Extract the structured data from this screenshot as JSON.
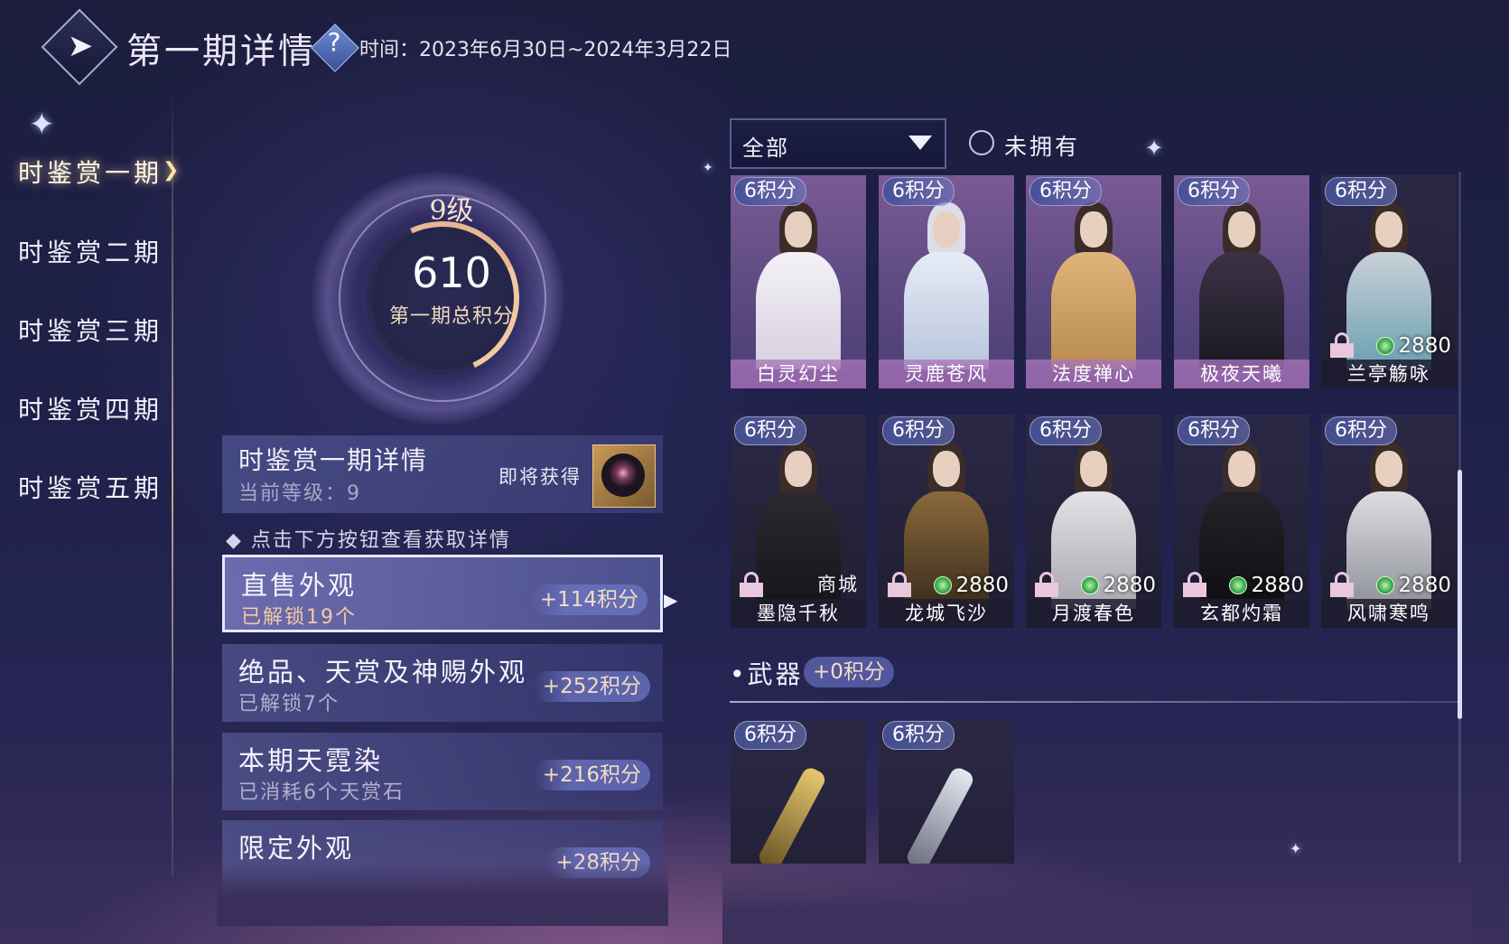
{
  "header": {
    "title": "第一期详情",
    "help_symbol": "?",
    "time_text": "时间：2023年6月30日~2024年3月22日"
  },
  "sidebar": {
    "items": [
      {
        "label": "时鉴赏一期",
        "active": true
      },
      {
        "label": "时鉴赏二期",
        "active": false
      },
      {
        "label": "时鉴赏三期",
        "active": false
      },
      {
        "label": "时鉴赏四期",
        "active": false
      },
      {
        "label": "时鉴赏五期",
        "active": false
      }
    ]
  },
  "score": {
    "level": "9级",
    "total": "610",
    "label": "第一期总积分"
  },
  "detail": {
    "title": "时鉴赏一期详情",
    "current_level": "当前等级：9",
    "soon_label": "即将获得",
    "hint": "点击下方按钮查看获取详情"
  },
  "categories": [
    {
      "name": "直售外观",
      "sub": "已解锁19个",
      "points": "+114积分",
      "active": true
    },
    {
      "name": "绝品、天赏及神赐外观",
      "sub": "已解锁7个",
      "points": "+252积分",
      "active": false
    },
    {
      "name": "本期天霓染",
      "sub": "已消耗6个天赏石",
      "points": "+216积分",
      "active": false
    },
    {
      "name": "限定外观",
      "sub": "",
      "points": "+28积分",
      "active": false
    }
  ],
  "filter": {
    "selected": "全部",
    "unowned_label": "未拥有"
  },
  "outfits": [
    {
      "points": "6积分",
      "name": "白灵幻尘",
      "price": "",
      "shop": "",
      "locked": false
    },
    {
      "points": "6积分",
      "name": "灵鹿苍风",
      "price": "",
      "shop": "",
      "locked": false
    },
    {
      "points": "6积分",
      "name": "法度禅心",
      "price": "",
      "shop": "",
      "locked": false
    },
    {
      "points": "6积分",
      "name": "极夜天曦",
      "price": "",
      "shop": "",
      "locked": false
    },
    {
      "points": "6积分",
      "name": "兰亭觞咏",
      "price": "2880",
      "shop": "",
      "locked": true
    },
    {
      "points": "6积分",
      "name": "墨隐千秋",
      "price": "",
      "shop": "商城",
      "locked": true
    },
    {
      "points": "6积分",
      "name": "龙城飞沙",
      "price": "2880",
      "shop": "",
      "locked": true
    },
    {
      "points": "6积分",
      "name": "月渡春色",
      "price": "2880",
      "shop": "",
      "locked": true
    },
    {
      "points": "6积分",
      "name": "玄都灼霜",
      "price": "2880",
      "shop": "",
      "locked": true
    },
    {
      "points": "6积分",
      "name": "风啸寒鸣",
      "price": "2880",
      "shop": "",
      "locked": true
    }
  ],
  "weapons": {
    "header": "武器",
    "points": "+0积分",
    "items": [
      {
        "points": "6积分"
      },
      {
        "points": "6积分"
      }
    ]
  },
  "colors": {
    "accent_gold": "#f1d9bf",
    "points_badge": "#6e78c8",
    "jade_currency": "#3fae55",
    "owned_card": "#7a5a94"
  }
}
